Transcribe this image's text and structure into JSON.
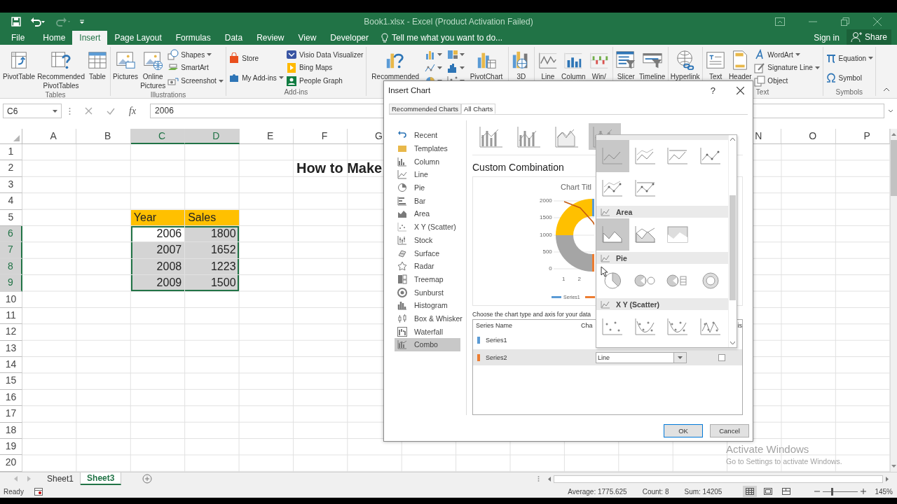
{
  "window": {
    "title": "Book1.xlsx - Excel (Product Activation Failed)"
  },
  "quick_access": [
    {
      "kind": "save",
      "disabled": false
    },
    {
      "kind": "undo",
      "disabled": false
    },
    {
      "kind": "redo",
      "disabled": true
    },
    {
      "kind": "customize",
      "disabled": false
    }
  ],
  "tabs": [
    {
      "label": "File",
      "selected": false
    },
    {
      "label": "Home",
      "selected": false
    },
    {
      "label": "Insert",
      "selected": true
    },
    {
      "label": "Page Layout",
      "selected": false
    },
    {
      "label": "Formulas",
      "selected": false
    },
    {
      "label": "Data",
      "selected": false
    },
    {
      "label": "Review",
      "selected": false
    },
    {
      "label": "View",
      "selected": false
    },
    {
      "label": "Developer",
      "selected": false
    }
  ],
  "tell_me": "Tell me what you want to do...",
  "account": {
    "sign_in": "Sign in",
    "share": "Share"
  },
  "ribbon": {
    "groups": [
      {
        "label": "Tables",
        "items": [
          {
            "kind": "large",
            "label": "PivotTable"
          },
          {
            "kind": "large",
            "label": "Recommended PivotTables"
          },
          {
            "kind": "large",
            "label": "Table"
          }
        ]
      },
      {
        "label": "Illustrations",
        "items": [
          {
            "kind": "large",
            "label": "Pictures"
          },
          {
            "kind": "large",
            "label": "Online Pictures"
          },
          {
            "kind": "stack",
            "items": [
              {
                "kind": "small",
                "label": "Shapes",
                "dropdown": true
              },
              {
                "kind": "small",
                "label": "SmartArt",
                "dropdown": false
              },
              {
                "kind": "small",
                "label": "Screenshot",
                "dropdown": true
              }
            ]
          }
        ]
      },
      {
        "label": "Add-ins",
        "items": [
          {
            "kind": "stack",
            "items": [
              {
                "kind": "small",
                "label": "Store",
                "dropdown": false
              },
              {
                "kind": "small",
                "label": "My Add-ins",
                "dropdown": true
              }
            ]
          },
          {
            "kind": "stack",
            "items": [
              {
                "kind": "small",
                "label": "Visio Data Visualizer",
                "dropdown": false
              },
              {
                "kind": "small",
                "label": "Bing Maps",
                "dropdown": false
              },
              {
                "kind": "small",
                "label": "People Graph",
                "dropdown": false
              }
            ]
          }
        ]
      },
      {
        "items": [
          {
            "kind": "large",
            "label": "Recommended"
          },
          {
            "kind": "stack",
            "items": [
              {
                "kind": "mini",
                "dropdown": true
              },
              {
                "kind": "mini",
                "dropdown": true
              },
              {
                "kind": "mini",
                "dropdown": true
              }
            ]
          },
          {
            "kind": "stack",
            "items": [
              {
                "kind": "mini",
                "dropdown": true
              },
              {
                "kind": "mini",
                "dropdown": true
              },
              {
                "kind": "mini",
                "dropdown": true
              }
            ]
          },
          {
            "kind": "large",
            "label": "PivotChart"
          }
        ]
      },
      {
        "items": [
          {
            "kind": "large",
            "label": "3D"
          }
        ]
      },
      {
        "items": [
          {
            "kind": "large",
            "label": "Line"
          },
          {
            "kind": "large",
            "label": "Column"
          },
          {
            "kind": "large",
            "label": "Win/"
          }
        ]
      },
      {
        "items": [
          {
            "kind": "large",
            "label": "Slicer"
          },
          {
            "kind": "large",
            "label": "Timeline"
          }
        ]
      },
      {
        "items": [
          {
            "kind": "large",
            "label": "Hyperlink"
          }
        ]
      },
      {
        "label": "Text",
        "items": [
          {
            "kind": "large",
            "label": "Text"
          },
          {
            "kind": "large",
            "label": "Header"
          },
          {
            "kind": "stack",
            "items": [
              {
                "kind": "small",
                "label": "WordArt",
                "dropdown": true
              },
              {
                "kind": "small",
                "label": "Signature Line",
                "dropdown": true
              },
              {
                "kind": "small",
                "label": "Object",
                "dropdown": false
              }
            ]
          }
        ]
      },
      {
        "label": "Symbols",
        "items": [
          {
            "kind": "stack",
            "items": [
              {
                "kind": "small",
                "label": "Equation",
                "dropdown": true
              },
              {
                "kind": "small",
                "label": "Symbol",
                "dropdown": false
              }
            ]
          }
        ]
      }
    ]
  },
  "formula_bar": {
    "name_box": "C6",
    "function_button": "fx",
    "value": "2006"
  },
  "sheet": {
    "columns": [
      {
        "label": "A",
        "selected": false
      },
      {
        "label": "B",
        "selected": false
      },
      {
        "label": "C",
        "selected": true
      },
      {
        "label": "D",
        "selected": true
      },
      {
        "label": "E",
        "selected": false
      },
      {
        "label": "F",
        "selected": false
      },
      {
        "label": "G",
        "selected": false
      }
    ],
    "columns_right": [
      {
        "label": "N",
        "selected": false
      },
      {
        "label": "O",
        "selected": false
      },
      {
        "label": "P",
        "selected": false
      }
    ],
    "rows": [
      {
        "label": "1",
        "selected": false
      },
      {
        "label": "2",
        "selected": false
      },
      {
        "label": "3",
        "selected": false
      },
      {
        "label": "4",
        "selected": false
      },
      {
        "label": "5",
        "selected": false
      },
      {
        "label": "6",
        "selected": true
      },
      {
        "label": "7",
        "selected": true
      },
      {
        "label": "8",
        "selected": true
      },
      {
        "label": "9",
        "selected": true
      },
      {
        "label": "10",
        "selected": false
      },
      {
        "label": "11",
        "selected": false
      },
      {
        "label": "12",
        "selected": false
      },
      {
        "label": "13",
        "selected": false
      },
      {
        "label": "14",
        "selected": false
      },
      {
        "label": "15",
        "selected": false
      },
      {
        "label": "16",
        "selected": false
      },
      {
        "label": "17",
        "selected": false
      },
      {
        "label": "18",
        "selected": false
      },
      {
        "label": "19",
        "selected": false
      },
      {
        "label": "20",
        "selected": false
      }
    ],
    "heading": "How to Make",
    "table": {
      "header": [
        "Year",
        "Sales"
      ],
      "rows": [
        {
          "cells": [
            "2006",
            "1800"
          ],
          "selected": true,
          "active": true
        },
        {
          "cells": [
            "2007",
            "1652"
          ],
          "selected": true,
          "active": false
        },
        {
          "cells": [
            "2008",
            "1223"
          ],
          "selected": true,
          "active": false
        },
        {
          "cells": [
            "2009",
            "1500"
          ],
          "selected": true,
          "active": false
        }
      ]
    }
  },
  "sheet_tabs": [
    {
      "label": "Sheet1",
      "selected": false
    },
    {
      "label": "Sheet3",
      "selected": true
    }
  ],
  "status_bar": {
    "mode": "Ready",
    "stats": [
      "Average: 1775.625",
      "Count: 8",
      "Sum: 14205"
    ],
    "views": [
      {
        "selected": true
      },
      {
        "selected": false
      },
      {
        "selected": false
      }
    ],
    "zoom": {
      "level": 0.25,
      "reading": "145%"
    }
  },
  "activation_notice": {
    "title": "Activate Windows",
    "detail": "Go to Settings to activate Windows."
  },
  "dialog": {
    "title": "Insert Chart",
    "help": "?",
    "tabs": [
      {
        "label": "Recommended Charts",
        "selected": false
      },
      {
        "label": "All Charts",
        "selected": true
      }
    ],
    "chart_types": [
      {
        "label": "Recent",
        "selected": false
      },
      {
        "label": "Templates",
        "selected": false
      },
      {
        "label": "Column",
        "selected": false
      },
      {
        "label": "Line",
        "selected": false
      },
      {
        "label": "Pie",
        "selected": false
      },
      {
        "label": "Bar",
        "selected": false
      },
      {
        "label": "Area",
        "selected": false
      },
      {
        "label": "X Y (Scatter)",
        "selected": false
      },
      {
        "label": "Stock",
        "selected": false
      },
      {
        "label": "Surface",
        "selected": false
      },
      {
        "label": "Radar",
        "selected": false
      },
      {
        "label": "Treemap",
        "selected": false
      },
      {
        "label": "Sunburst",
        "selected": false
      },
      {
        "label": "Histogram",
        "selected": false
      },
      {
        "label": "Box & Whisker",
        "selected": false
      },
      {
        "label": "Waterfall",
        "selected": false
      },
      {
        "label": "Combo",
        "selected": true
      }
    ],
    "subtypes": [
      {
        "selected": false
      },
      {
        "selected": false
      },
      {
        "selected": false
      },
      {
        "selected": true
      }
    ],
    "heading": "Custom Combination",
    "preview": {
      "title": "Chart Titl",
      "y_ticks": [
        "2000",
        "1500",
        "1000",
        "500",
        "0"
      ],
      "x_ticks": [
        "1",
        "2"
      ],
      "legend": [
        {
          "label": "Series1",
          "color": "#5b9bd5"
        },
        {
          "color": "#ed7d31"
        }
      ]
    },
    "instruction": "Choose the chart type and axis for your data",
    "series_columns": [
      "Series Name",
      "Cha",
      "is"
    ],
    "series": [
      {
        "name": "Series1",
        "color": "#5b9bd5",
        "selected": false
      },
      {
        "name": "Series2",
        "color": "#ed7d31",
        "selected": true,
        "chart_type": "Line",
        "secondary_axis": false
      }
    ],
    "buttons": [
      {
        "label": "OK",
        "kind": "primary"
      },
      {
        "label": "Cancel",
        "kind": "normal"
      }
    ],
    "type_menu": {
      "sections": [
        {
          "kind": "line",
          "options": [
            {
              "selected": true
            },
            {
              "selected": false
            },
            {
              "selected": false
            },
            {
              "selected": false
            },
            {
              "selected": false
            },
            {
              "selected": false
            }
          ]
        },
        {
          "kind": "area",
          "heading": "Area",
          "options": [
            {
              "selected": true
            },
            {
              "selected": false
            },
            {
              "selected": false
            }
          ]
        },
        {
          "kind": "pie",
          "heading": "Pie",
          "options": [
            {
              "selected": false
            },
            {
              "selected": false
            },
            {
              "selected": false
            },
            {
              "selected": false
            }
          ]
        },
        {
          "kind": "scatter",
          "heading": "X Y (Scatter)",
          "options": [
            {
              "selected": false
            },
            {
              "selected": false
            },
            {
              "selected": false
            },
            {
              "selected": false
            }
          ]
        }
      ]
    }
  }
}
